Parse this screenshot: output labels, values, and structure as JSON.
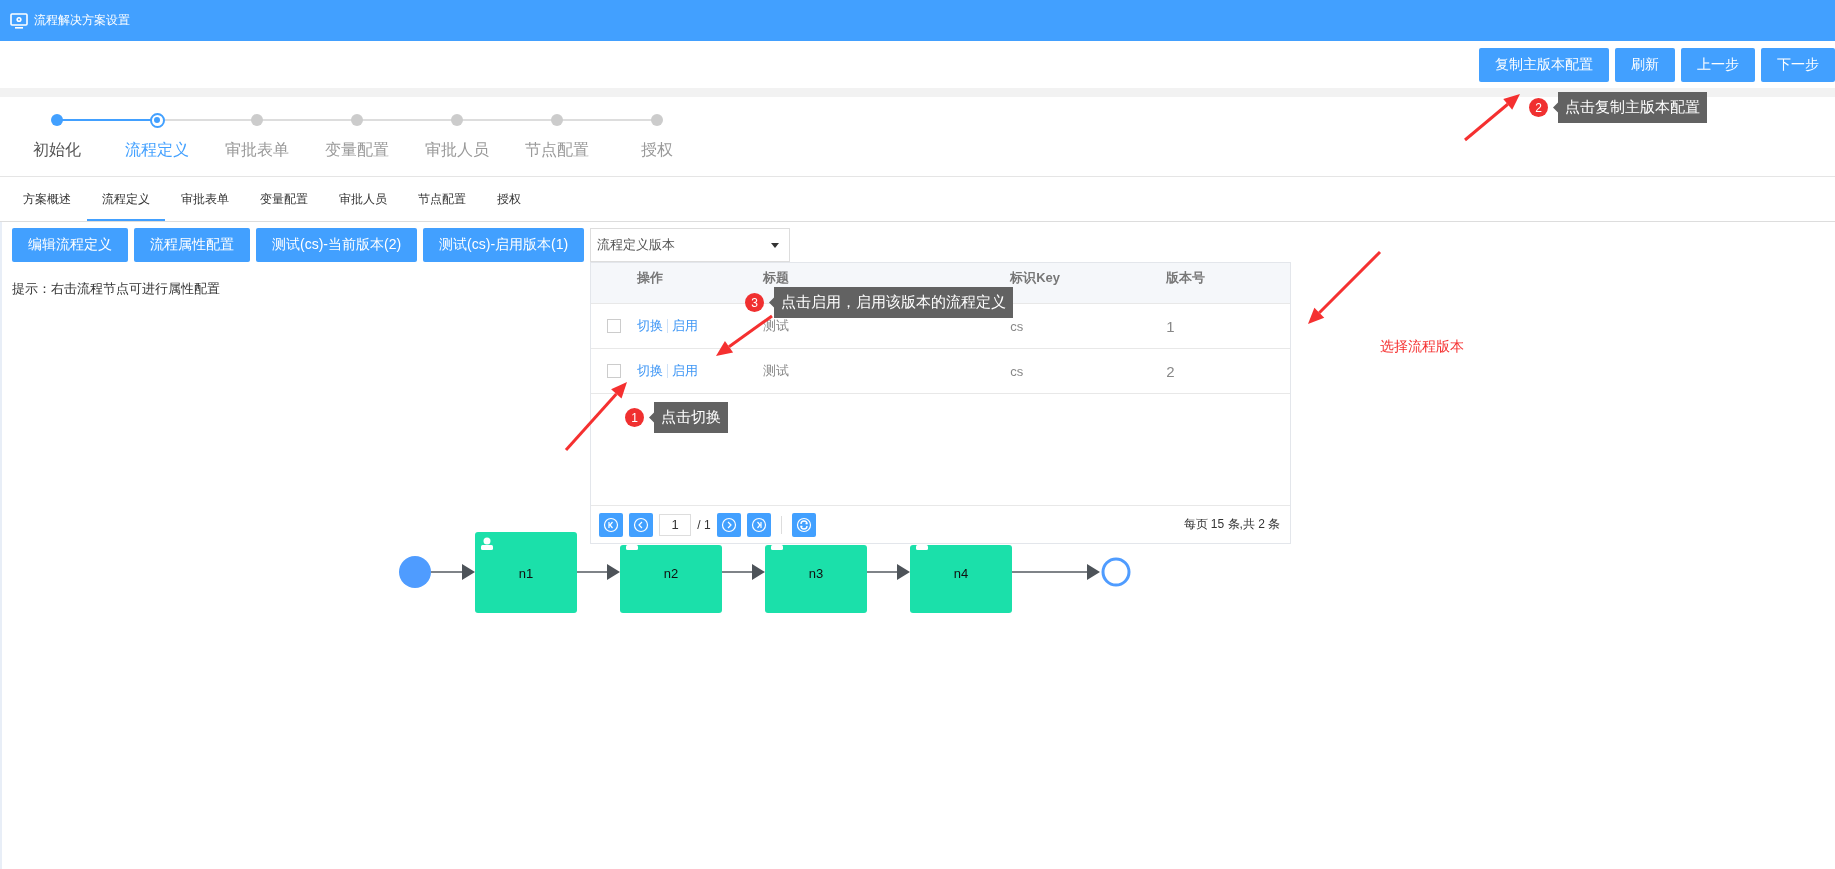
{
  "window": {
    "title": "流程解决方案设置"
  },
  "header_buttons": [
    "复制主版本配置",
    "刷新",
    "上一步",
    "下一步"
  ],
  "steps": [
    {
      "label": "初始化",
      "completed": true,
      "selected": false
    },
    {
      "label": "流程定义",
      "completed": false,
      "selected": true
    },
    {
      "label": "审批表单",
      "completed": false,
      "selected": false
    },
    {
      "label": "变量配置",
      "completed": false,
      "selected": false
    },
    {
      "label": "审批人员",
      "completed": false,
      "selected": false
    },
    {
      "label": "节点配置",
      "completed": false,
      "selected": false
    },
    {
      "label": "授权",
      "completed": false,
      "selected": false
    }
  ],
  "tabs": [
    {
      "label": "方案概述",
      "selected": false
    },
    {
      "label": "流程定义",
      "selected": true
    },
    {
      "label": "审批表单",
      "selected": false
    },
    {
      "label": "变量配置",
      "selected": false
    },
    {
      "label": "审批人员",
      "selected": false
    },
    {
      "label": "节点配置",
      "selected": false
    },
    {
      "label": "授权",
      "selected": false
    }
  ],
  "toolbar_buttons": [
    "编辑流程定义",
    "流程属性配置",
    "测试(cs)-当前版本(2)",
    "测试(cs)-启用版本(1)"
  ],
  "version_select": {
    "placeholder": "流程定义版本"
  },
  "hint": "提示：右击流程节点可进行属性配置",
  "version_table": {
    "columns": [
      "操作",
      "标题",
      "标识Key",
      "版本号"
    ],
    "rows": [
      {
        "checked": false,
        "actions": [
          "切换",
          "启用"
        ],
        "title": "测试",
        "key": "cs",
        "version": "1"
      },
      {
        "checked": false,
        "actions": [
          "切换",
          "启用"
        ],
        "title": "测试",
        "key": "cs",
        "version": "2"
      }
    ],
    "pager": {
      "page": "1",
      "pages": "/ 1",
      "summary": "每页 15 条,共 2 条"
    }
  },
  "diagram": {
    "nodes": [
      {
        "kind": "start"
      },
      {
        "kind": "task",
        "label": "n1"
      },
      {
        "kind": "task",
        "label": "n2"
      },
      {
        "kind": "task",
        "label": "n3"
      },
      {
        "kind": "task",
        "label": "n4"
      },
      {
        "kind": "end"
      }
    ]
  },
  "annotations": [
    {
      "kind": "callout",
      "number": "2",
      "text": "点击复制主版本配置"
    },
    {
      "kind": "note",
      "text": "选择流程版本"
    },
    {
      "kind": "callout",
      "number": "3",
      "text": "点击启用，启用该版本的流程定义"
    },
    {
      "kind": "callout",
      "number": "1",
      "text": "点击切换"
    }
  ]
}
